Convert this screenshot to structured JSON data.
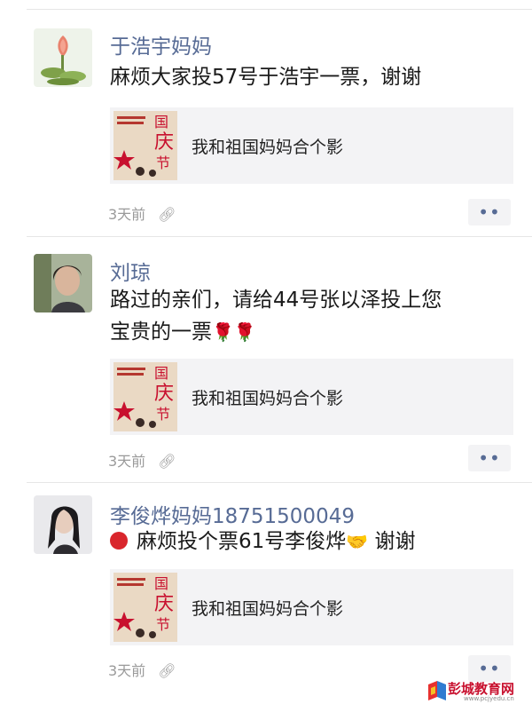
{
  "posts": [
    {
      "author": "于浩宇妈妈",
      "text": "麻烦大家投57号于浩宇一票，谢谢",
      "text_parts": [
        "麻烦大家投57号于浩宇一票，谢谢"
      ],
      "share_title": "我和祖国妈妈合个影",
      "time": "3天前",
      "avatar_icon": "lotus-flower-avatar-icon"
    },
    {
      "author": "刘琼",
      "text": "路过的亲们，请给44号张以泽投上您宝贵的一票🌹🌹",
      "text_parts": [
        "路过的亲们，请给44号张以泽投上您",
        "宝贵的一票"
      ],
      "emoji": "🌹🌹",
      "share_title": "我和祖国妈妈合个影",
      "time": "3天前",
      "avatar_icon": "woman-portrait-avatar-icon"
    },
    {
      "author": "李俊烨妈妈18751500049",
      "text": "🔴 麻烦投个票61号李俊烨🤝 谢谢",
      "text_parts": [
        "麻烦投个票61号李俊烨",
        "谢谢"
      ],
      "emoji": "🤝",
      "share_title": "我和祖国妈妈合个影",
      "time": "3天前",
      "avatar_icon": "woman-portrait-avatar-icon"
    }
  ],
  "thumbnail": {
    "chars": [
      "国",
      "庆",
      "节"
    ],
    "colors": {
      "red": "#c8102e",
      "paper": "#ead9c4"
    }
  },
  "more_label": "••",
  "watermark": {
    "name": "彭城教育网",
    "url": "www.pcjyedu.cn"
  },
  "colors": {
    "name": "#576b95",
    "meta": "#9a9a9a",
    "share_bg": "#f3f3f5"
  }
}
